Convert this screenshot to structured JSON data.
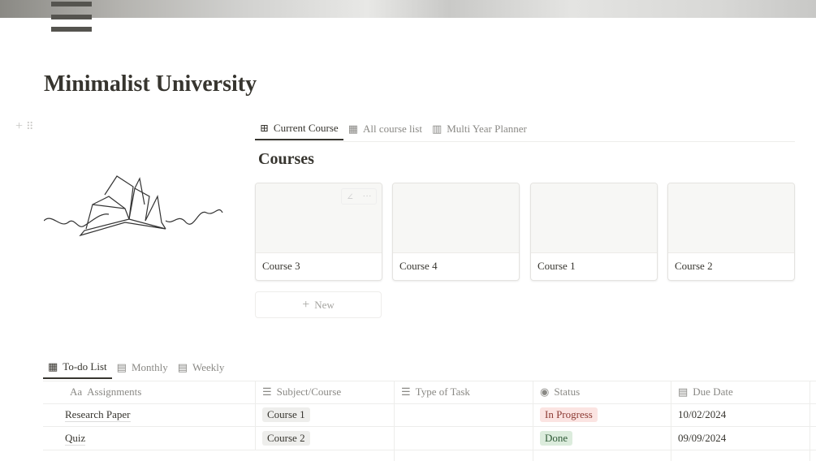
{
  "page": {
    "title": "Minimalist University"
  },
  "courses_view": {
    "tabs": [
      {
        "label": "Current Course",
        "icon": "gallery-icon"
      },
      {
        "label": "All course list",
        "icon": "table-icon"
      },
      {
        "label": "Multi Year Planner",
        "icon": "board-icon"
      }
    ],
    "heading": "Courses",
    "cards": [
      "Course 3",
      "Course 4",
      "Course 1",
      "Course 2"
    ],
    "new_label": "New"
  },
  "todo_view": {
    "tabs": [
      {
        "label": "To-do List",
        "icon": "table-icon"
      },
      {
        "label": "Monthly",
        "icon": "calendar-icon"
      },
      {
        "label": "Weekly",
        "icon": "calendar-icon"
      }
    ],
    "columns": [
      {
        "label": "Assignments",
        "icon": "Aa"
      },
      {
        "label": "Subject/Course",
        "icon": "list-icon"
      },
      {
        "label": "Type of Task",
        "icon": "list-icon"
      },
      {
        "label": "Status",
        "icon": "status-icon"
      },
      {
        "label": "Due Date",
        "icon": "calendar-icon"
      }
    ],
    "rows": [
      {
        "assignment": "Research Paper",
        "course": "Course 1",
        "type": "",
        "status": "In Progress",
        "due": "10/02/2024"
      },
      {
        "assignment": "Quiz",
        "course": "Course 2",
        "type": "",
        "status": "Done",
        "due": "09/09/2024"
      }
    ]
  },
  "colors": {
    "in_progress_bg": "#fbe4e2",
    "in_progress_fg": "#8c3a33",
    "done_bg": "#dcecdd",
    "done_fg": "#2f5a37",
    "tag_bg": "#eeeeec"
  }
}
